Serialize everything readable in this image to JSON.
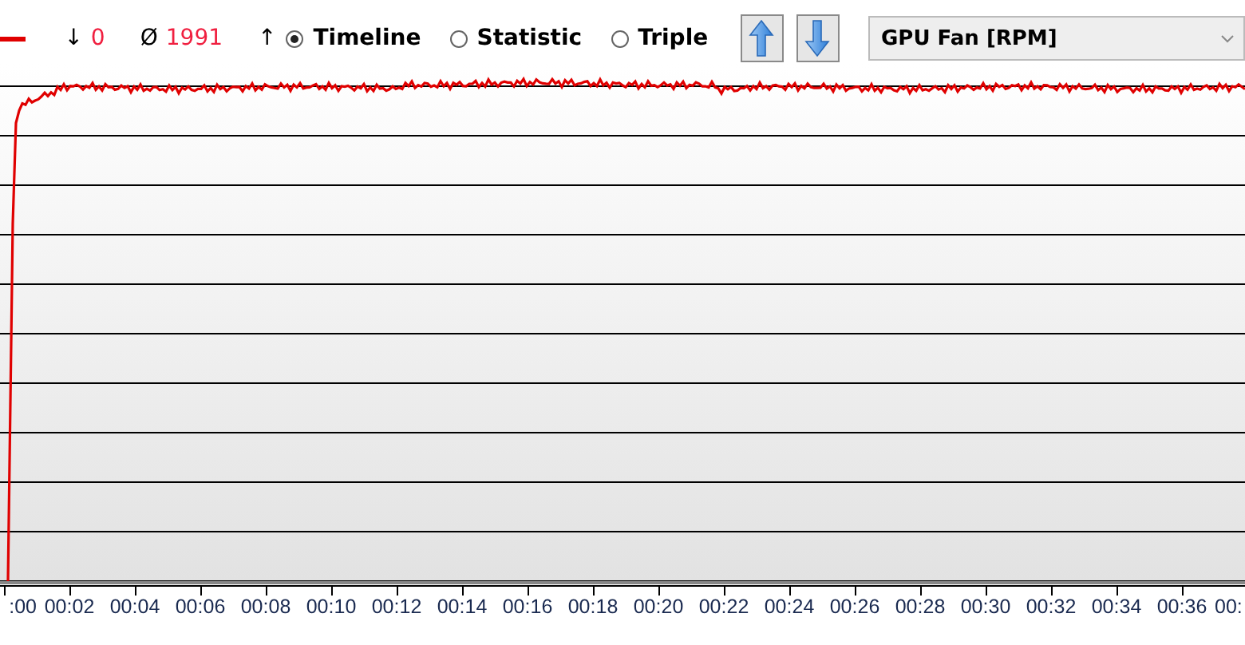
{
  "stats": [
    {
      "symbol": "↓",
      "value": "0"
    },
    {
      "symbol": "Ø",
      "value": "1991"
    },
    {
      "symbol": "↑"
    }
  ],
  "view_modes": [
    {
      "label": "Timeline",
      "selected": true
    },
    {
      "label": "Statistic",
      "selected": false
    },
    {
      "label": "Triple",
      "selected": false
    }
  ],
  "sensor_select": {
    "value": "GPU Fan [RPM]"
  },
  "x_axis_labels": [
    ":00",
    "00:02",
    "00:04",
    "00:06",
    "00:08",
    "00:10",
    "00:12",
    "00:14",
    "00:16",
    "00:18",
    "00:20",
    "00:22",
    "00:24",
    "00:26",
    "00:28",
    "00:30",
    "00:32",
    "00:34",
    "00:36",
    "00:"
  ]
}
